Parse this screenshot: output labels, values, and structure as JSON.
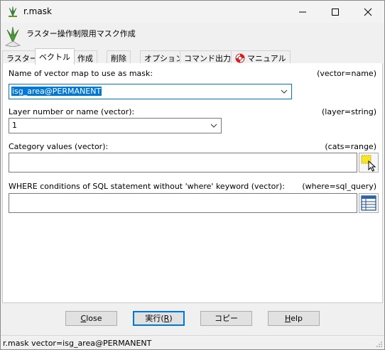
{
  "window": {
    "title": "r.mask"
  },
  "header": {
    "description": "ラスター操作制限用マスク作成"
  },
  "tabs": [
    {
      "label": "ラスター"
    },
    {
      "label": "ベクトル"
    },
    {
      "label": "作成"
    },
    {
      "label": "削除"
    },
    {
      "label": "オプション"
    },
    {
      "label": "コマンド出力"
    },
    {
      "label": "マニュアル"
    }
  ],
  "form": {
    "vector_label": "Name of vector map to use as mask:",
    "vector_param": "(vector=name)",
    "vector_value": "isg_area@PERMANENT",
    "layer_label": "Layer number or name (vector):",
    "layer_param": "(layer=string)",
    "layer_value": "1",
    "cats_label": "Category values (vector):",
    "cats_param": "(cats=range)",
    "cats_value": "",
    "where_label": "WHERE conditions of SQL statement without 'where' keyword (vector):",
    "where_param": "(where=sql_query)",
    "where_value": ""
  },
  "buttons": {
    "close": {
      "mnemonic": "C",
      "rest": "lose"
    },
    "run": {
      "pre": "実行(",
      "mnemonic": "R",
      "post": ")"
    },
    "copy": {
      "label": "コピー"
    },
    "help": {
      "mnemonic": "H",
      "rest": "elp"
    }
  },
  "status": {
    "command": "r.mask vector=isg_area@PERMANENT"
  }
}
